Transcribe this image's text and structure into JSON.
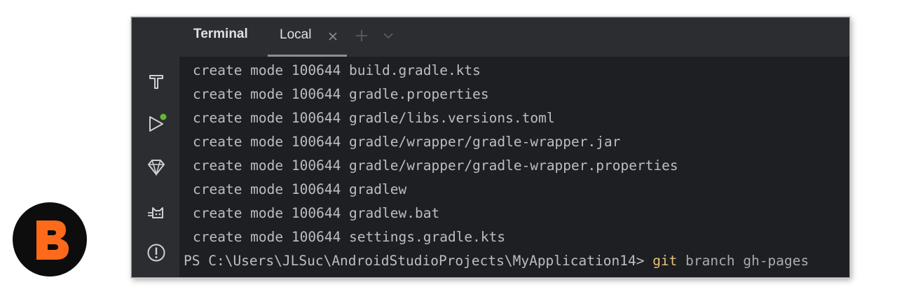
{
  "tool_window": {
    "title": "Terminal",
    "tabs": [
      {
        "label": "Local",
        "active": true
      }
    ]
  },
  "sidebar": {
    "icons": [
      "build-hammer-icon",
      "run-icon",
      "gem-icon",
      "cat-icon",
      "problems-icon"
    ],
    "run_status_color": "#5fb832"
  },
  "terminal": {
    "lines": [
      "create mode 100644 build.gradle.kts",
      "create mode 100644 gradle.properties",
      "create mode 100644 gradle/libs.versions.toml",
      "create mode 100644 gradle/wrapper/gradle-wrapper.jar",
      "create mode 100644 gradle/wrapper/gradle-wrapper.properties",
      "create mode 100644 gradlew",
      "create mode 100644 gradlew.bat",
      "create mode 100644 settings.gradle.kts"
    ],
    "prompt": "PS C:\\Users\\JLSuc\\AndroidStudioProjects\\MyApplication14> ",
    "command": "git",
    "command_args": " branch gh-pages"
  },
  "colors": {
    "background": "#1e1f22",
    "panel": "#2b2d30",
    "text": "#bcbec4",
    "command_highlight": "#e5c07b",
    "brand_orange": "#ff6a1a"
  },
  "logo": {
    "icon": "brand-b-logo-icon"
  }
}
